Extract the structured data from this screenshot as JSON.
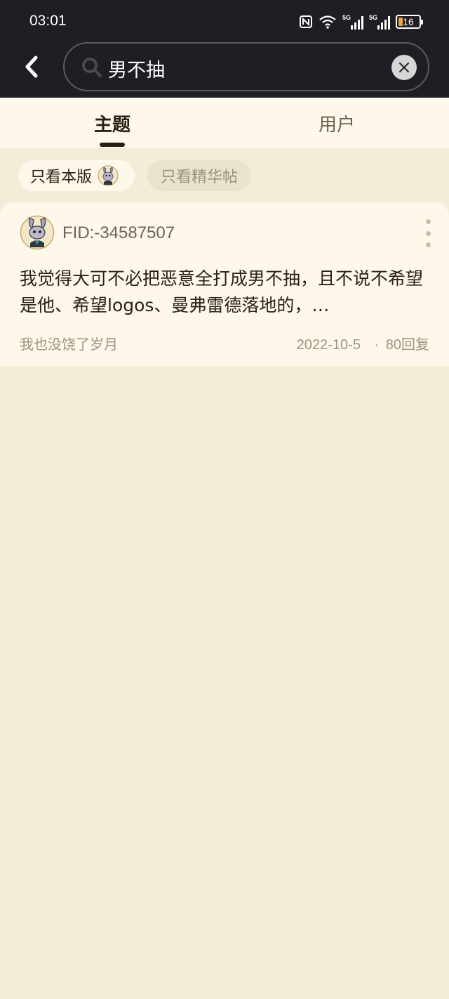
{
  "status_bar": {
    "time": "03:01",
    "signal1_label": "5G",
    "signal2_label": "5G",
    "battery": "16"
  },
  "search": {
    "query": "男不抽"
  },
  "tabs": [
    {
      "label": "主题",
      "active": true
    },
    {
      "label": "用户",
      "active": false
    }
  ],
  "filters": {
    "this_forum": "只看本版",
    "featured": "只看精华帖"
  },
  "post": {
    "author": "FID:-34587507",
    "body": "我觉得大可不必把恶意全打成男不抽，且不说不希望是他、希望logos、曼弗雷德落地的，…",
    "forum": "我也没饶了岁月",
    "date": "2022-10-5",
    "replies": "80回复",
    "separator": "·"
  },
  "colors": {
    "topbar_bg": "#1f1e25",
    "page_bg": "#f3ecd7",
    "card_bg": "#fdf8e9"
  }
}
